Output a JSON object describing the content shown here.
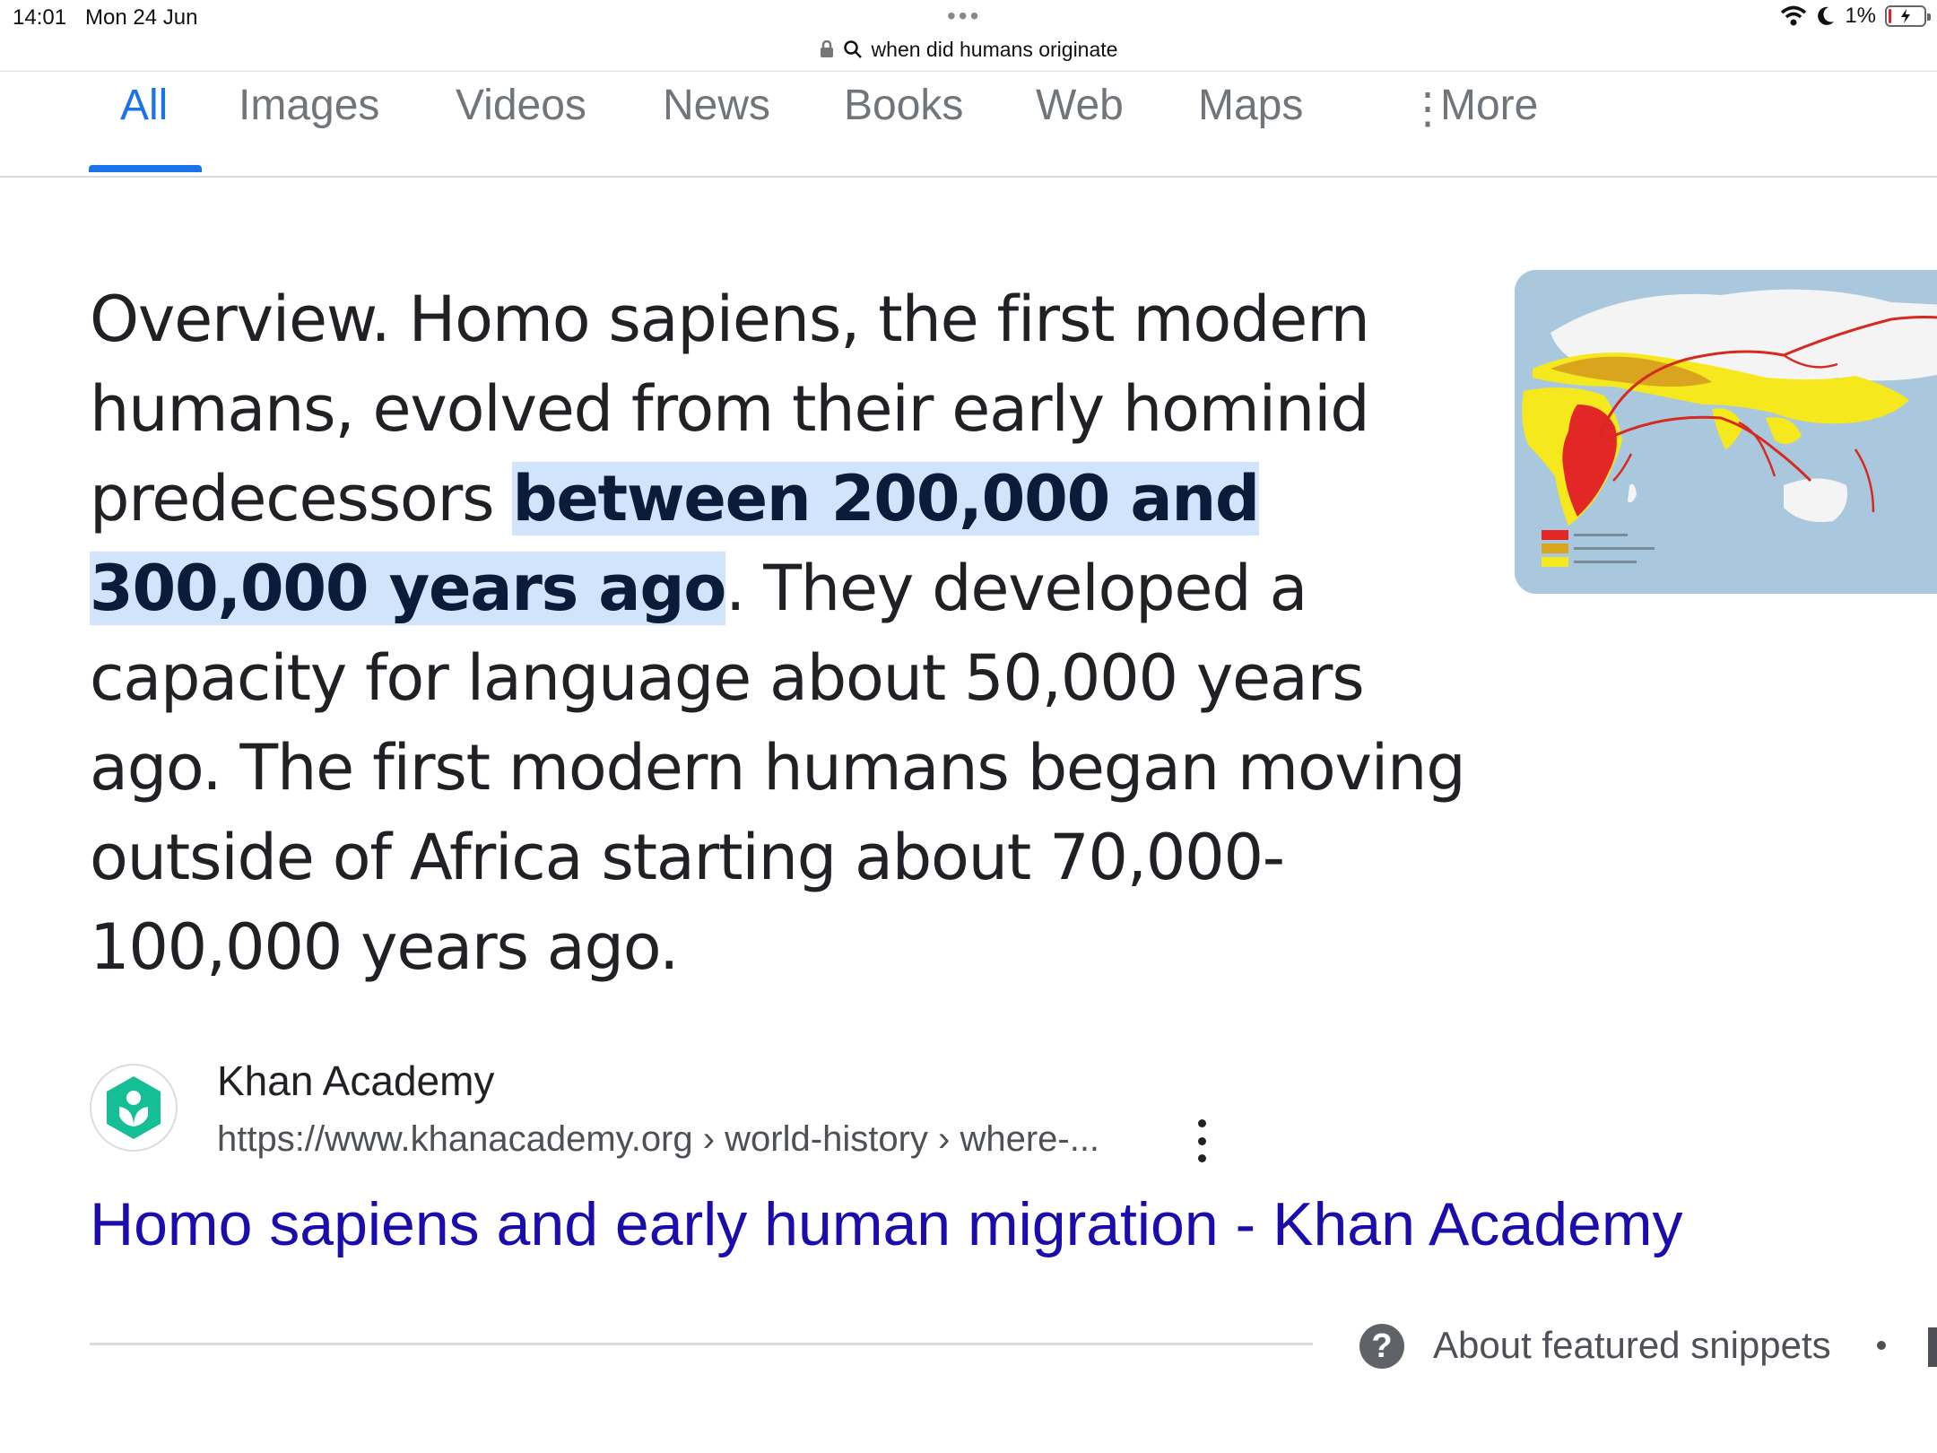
{
  "status_bar": {
    "time": "14:01",
    "date": "Mon 24 Jun",
    "battery": "1%"
  },
  "url_bar": {
    "query": "when did humans originate"
  },
  "tabs": [
    {
      "label": "All",
      "active": true
    },
    {
      "label": "Images",
      "active": false
    },
    {
      "label": "Videos",
      "active": false
    },
    {
      "label": "News",
      "active": false
    },
    {
      "label": "Books",
      "active": false
    },
    {
      "label": "Web",
      "active": false
    },
    {
      "label": "Maps",
      "active": false
    }
  ],
  "more_label": "More",
  "snippet": {
    "before": "Overview. Homo sapiens, the first modern humans, evolved from their early hominid predecessors ",
    "highlight": "between 200,000 and 300,000 years ago",
    "after": ". They developed a capacity for language about 50,000 years ago. The first modern humans began moving outside of Africa starting about 70,000-100,000 years ago."
  },
  "source": {
    "name": "Khan Academy",
    "url": "https://www.khanacademy.org › world-history › where-...",
    "title": "Homo sapiens and early human migration - Khan Academy"
  },
  "footer": {
    "about": "About featured snippets"
  },
  "colors": {
    "accent": "#1a73e8",
    "link": "#1a0dab",
    "highlight": "#d2e3fc",
    "khan_green": "#14bf96"
  }
}
